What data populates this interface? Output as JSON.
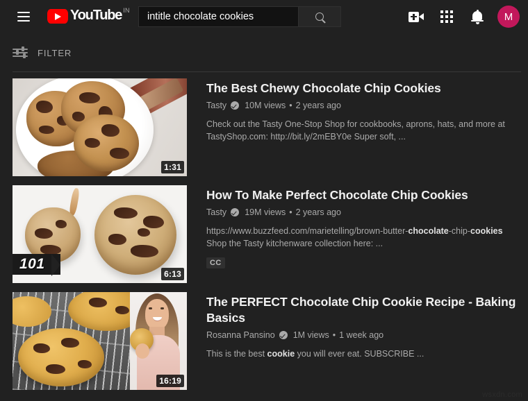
{
  "header": {
    "menu_icon": "hamburger-menu-icon",
    "logo_text": "YouTube",
    "logo_country": "IN",
    "search": {
      "value": "intitle chocolate cookies",
      "placeholder": "Search",
      "submit_icon": "search-icon"
    },
    "actions": [
      {
        "name": "create-video-icon",
        "label": "Create"
      },
      {
        "name": "apps-grid-icon",
        "label": "YouTube apps"
      },
      {
        "name": "notifications-bell-icon",
        "label": "Notifications"
      }
    ],
    "avatar_initial": "M",
    "avatar_color": "#c2185b"
  },
  "filter_bar": {
    "icon": "filter-sliders-icon",
    "label": "FILTER"
  },
  "results": [
    {
      "title": "The Best Chewy Chocolate Chip Cookies",
      "channel": "Tasty",
      "verified": true,
      "views": "10M views",
      "published": "2 years ago",
      "separator": "•",
      "duration": "1:31",
      "description_parts": [
        {
          "text": "Check out the Tasty One-Stop Shop for cookbooks, aprons, hats, and more at TastyShop.com: http://bit.ly/2mEBY0e Super soft, ...",
          "bold": false
        }
      ],
      "cc": false,
      "thumb_overlay": null
    },
    {
      "title": "How To Make Perfect Chocolate Chip Cookies",
      "channel": "Tasty",
      "verified": true,
      "views": "19M views",
      "published": "2 years ago",
      "separator": "•",
      "duration": "6:13",
      "description_parts": [
        {
          "text": "https://www.buzzfeed.com/marietelling/brown-butter-",
          "bold": false
        },
        {
          "text": "chocolate",
          "bold": true
        },
        {
          "text": "-chip-",
          "bold": false
        },
        {
          "text": "cookies",
          "bold": true
        },
        {
          "text": " Shop the Tasty kitchenware collection here: ...",
          "bold": false
        }
      ],
      "cc": true,
      "cc_label": "CC",
      "thumb_overlay": "101"
    },
    {
      "title": "The PERFECT Chocolate Chip Cookie Recipe - Baking Basics",
      "channel": "Rosanna Pansino",
      "verified": true,
      "views": "1M views",
      "published": "1 week ago",
      "separator": "•",
      "duration": "16:19",
      "description_parts": [
        {
          "text": "This is the best ",
          "bold": false
        },
        {
          "text": "cookie",
          "bold": true
        },
        {
          "text": " you will ever eat. SUBSCRIBE ...",
          "bold": false
        }
      ],
      "cc": false,
      "thumb_overlay": null
    }
  ],
  "watermark": "wsxdn.com"
}
